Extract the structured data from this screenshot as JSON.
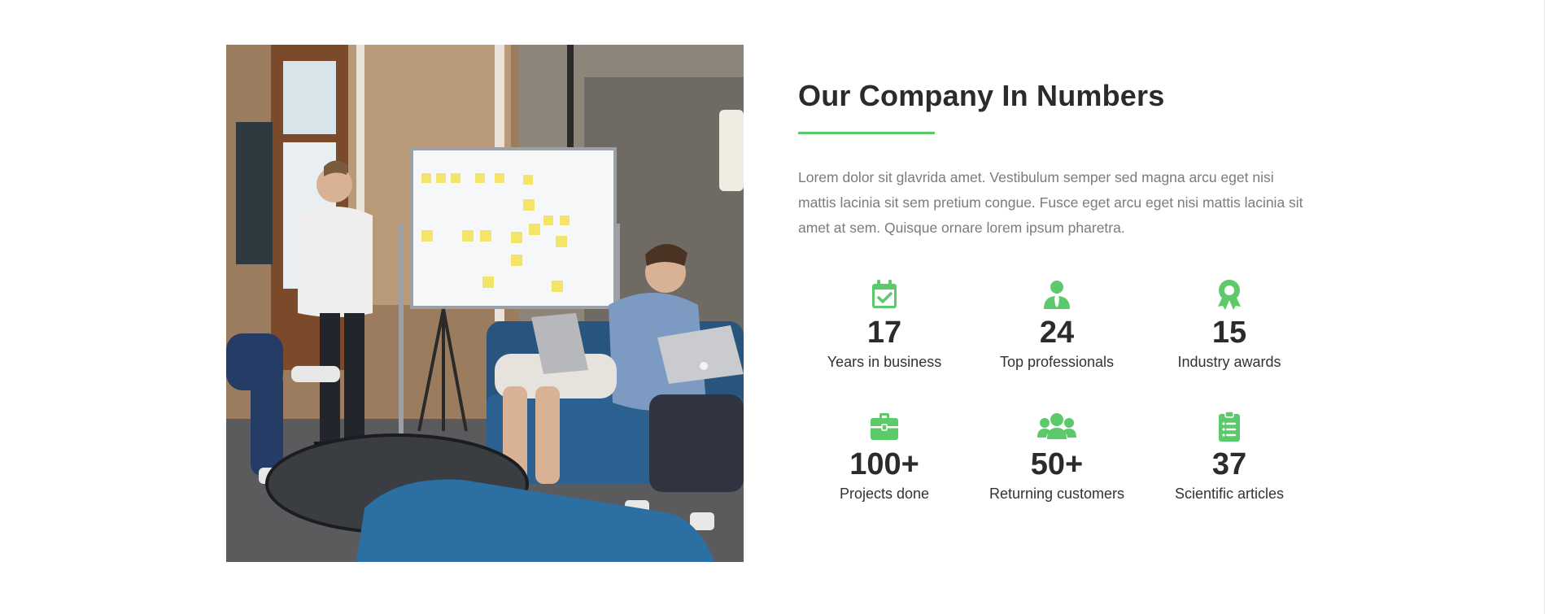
{
  "section": {
    "heading": "Our Company In Numbers",
    "intro": "Lorem dolor sit glavrida amet. Vestibulum semper sed magna arcu eget nisi mattis lacinia sit sem pretium congue. Fusce eget arcu eget nisi mattis lacinia sit amet at sem. Quisque ornare lorem ipsum pharetra.",
    "accent_color": "#5cc96b"
  },
  "photo": {
    "subject": "team meeting in an office with a whiteboard"
  },
  "stats": [
    {
      "icon": "calendar-check-icon",
      "number": "17",
      "label": "Years in business"
    },
    {
      "icon": "user-tie-icon",
      "number": "24",
      "label": "Top professionals"
    },
    {
      "icon": "award-icon",
      "number": "15",
      "label": "Industry awards"
    },
    {
      "icon": "briefcase-icon",
      "number": "100+",
      "label": "Projects done"
    },
    {
      "icon": "users-icon",
      "number": "50+",
      "label": "Returning customers"
    },
    {
      "icon": "clipboard-list-icon",
      "number": "37",
      "label": "Scientific articles"
    }
  ]
}
